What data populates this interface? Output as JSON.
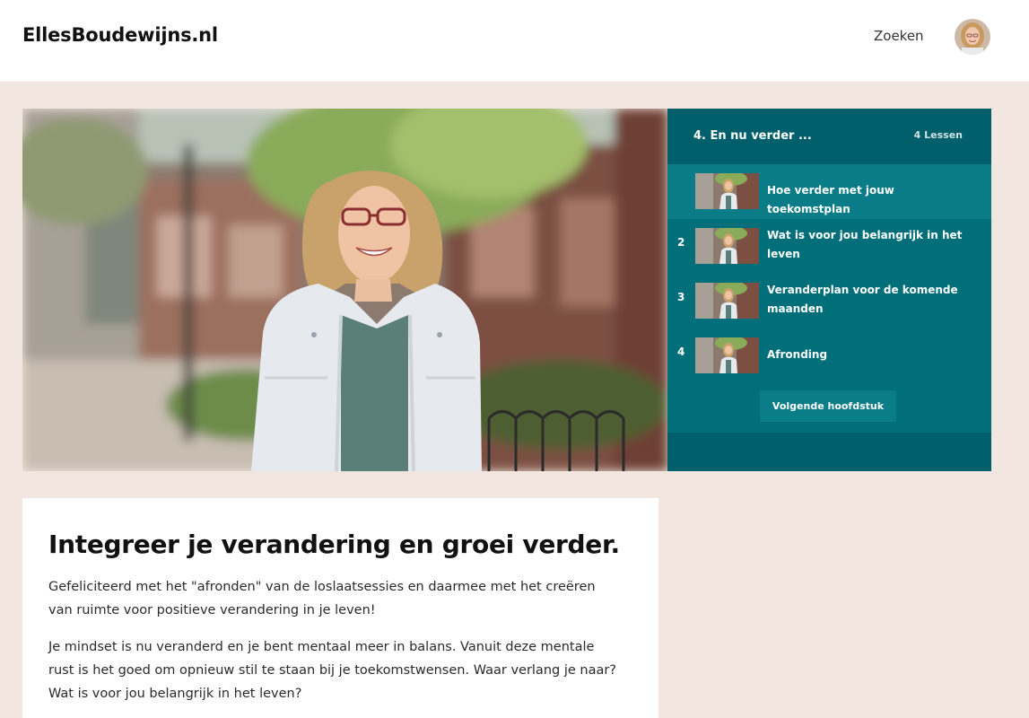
{
  "header": {
    "logo": "EllesBoudewijns.nl",
    "search_label": "Zoeken"
  },
  "chapter": {
    "title": "4. En nu verder ...",
    "lesson_count": "4 Lessen",
    "lessons": [
      {
        "number": "",
        "title": "Hoe verder met jouw toekomstplan",
        "active": true
      },
      {
        "number": "2",
        "title": "Wat is voor jou belangrijk in het leven",
        "active": false
      },
      {
        "number": "3",
        "title": "Veranderplan voor de komende maanden",
        "active": false
      },
      {
        "number": "4",
        "title": "Afronding",
        "active": false
      }
    ],
    "next_label": "Volgende hoofdstuk"
  },
  "content": {
    "title": "Integreer je verandering en groei verder.",
    "paragraphs": [
      "Gefeliciteerd met het \"afronden\" van de loslaatsessies en daarmee met het creëren van ruimte voor positieve verandering in je leven!",
      "Je mindset is nu veranderd en je bent mentaal meer in balans. Vanuit deze mentale rust is het goed om opnieuw stil te staan bij je toekomstwensen. Waar verlang je naar? Wat is voor jou belangrijk in het leven?"
    ]
  },
  "colors": {
    "page_bg": "#f2e6e0",
    "panel_bg": "#006f7a",
    "panel_dark": "#005f6a",
    "active_lesson": "#0a7c87"
  }
}
